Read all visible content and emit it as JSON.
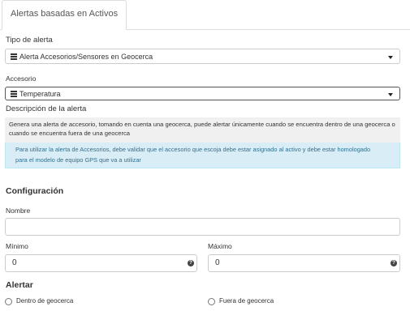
{
  "tabs": [
    {
      "label": "Alertas basadas en Activos"
    }
  ],
  "tipo_alerta": {
    "label": "Tipo de alerta",
    "value": "Alerta Accesorios/Sensores en Geocerca",
    "icon": "list-icon"
  },
  "accesorio": {
    "label": "Accesorio",
    "value": "Temperatura",
    "icon": "list-icon"
  },
  "descripcion": {
    "label": "Descripción de la alerta",
    "text_line1": "Genera una alerta de accesorio, tomando en cuenta una geocerca, puede alertar únicamente cuando se encuentra dentro de una geocerca o",
    "text_line2": "cuando se encuentra fuera de una geocerca",
    "info_line1": "Para utilizar la alerta de Accesorios, debe validar que el accesorio que escoja debe estar asignado al activo y debe estar homologado",
    "info_line2": "para el modelo de equipo GPS que va a utilizar"
  },
  "configuracion": {
    "heading": "Configuración",
    "nombre": {
      "label": "Nombre",
      "value": ""
    },
    "minimo": {
      "label": "Mínimo",
      "value": "0",
      "help": "?"
    },
    "maximo": {
      "label": "Máximo",
      "value": "0",
      "help": "?"
    }
  },
  "alertar": {
    "heading": "Alertar",
    "options": [
      {
        "label": "Dentro de geocerca",
        "selected": false
      },
      {
        "label": "Fuera de geocerca",
        "selected": false
      }
    ]
  },
  "colors": {
    "info_bg": "#d9edf7",
    "info_text": "#31708f",
    "desc_bg": "#f0f0f0"
  }
}
